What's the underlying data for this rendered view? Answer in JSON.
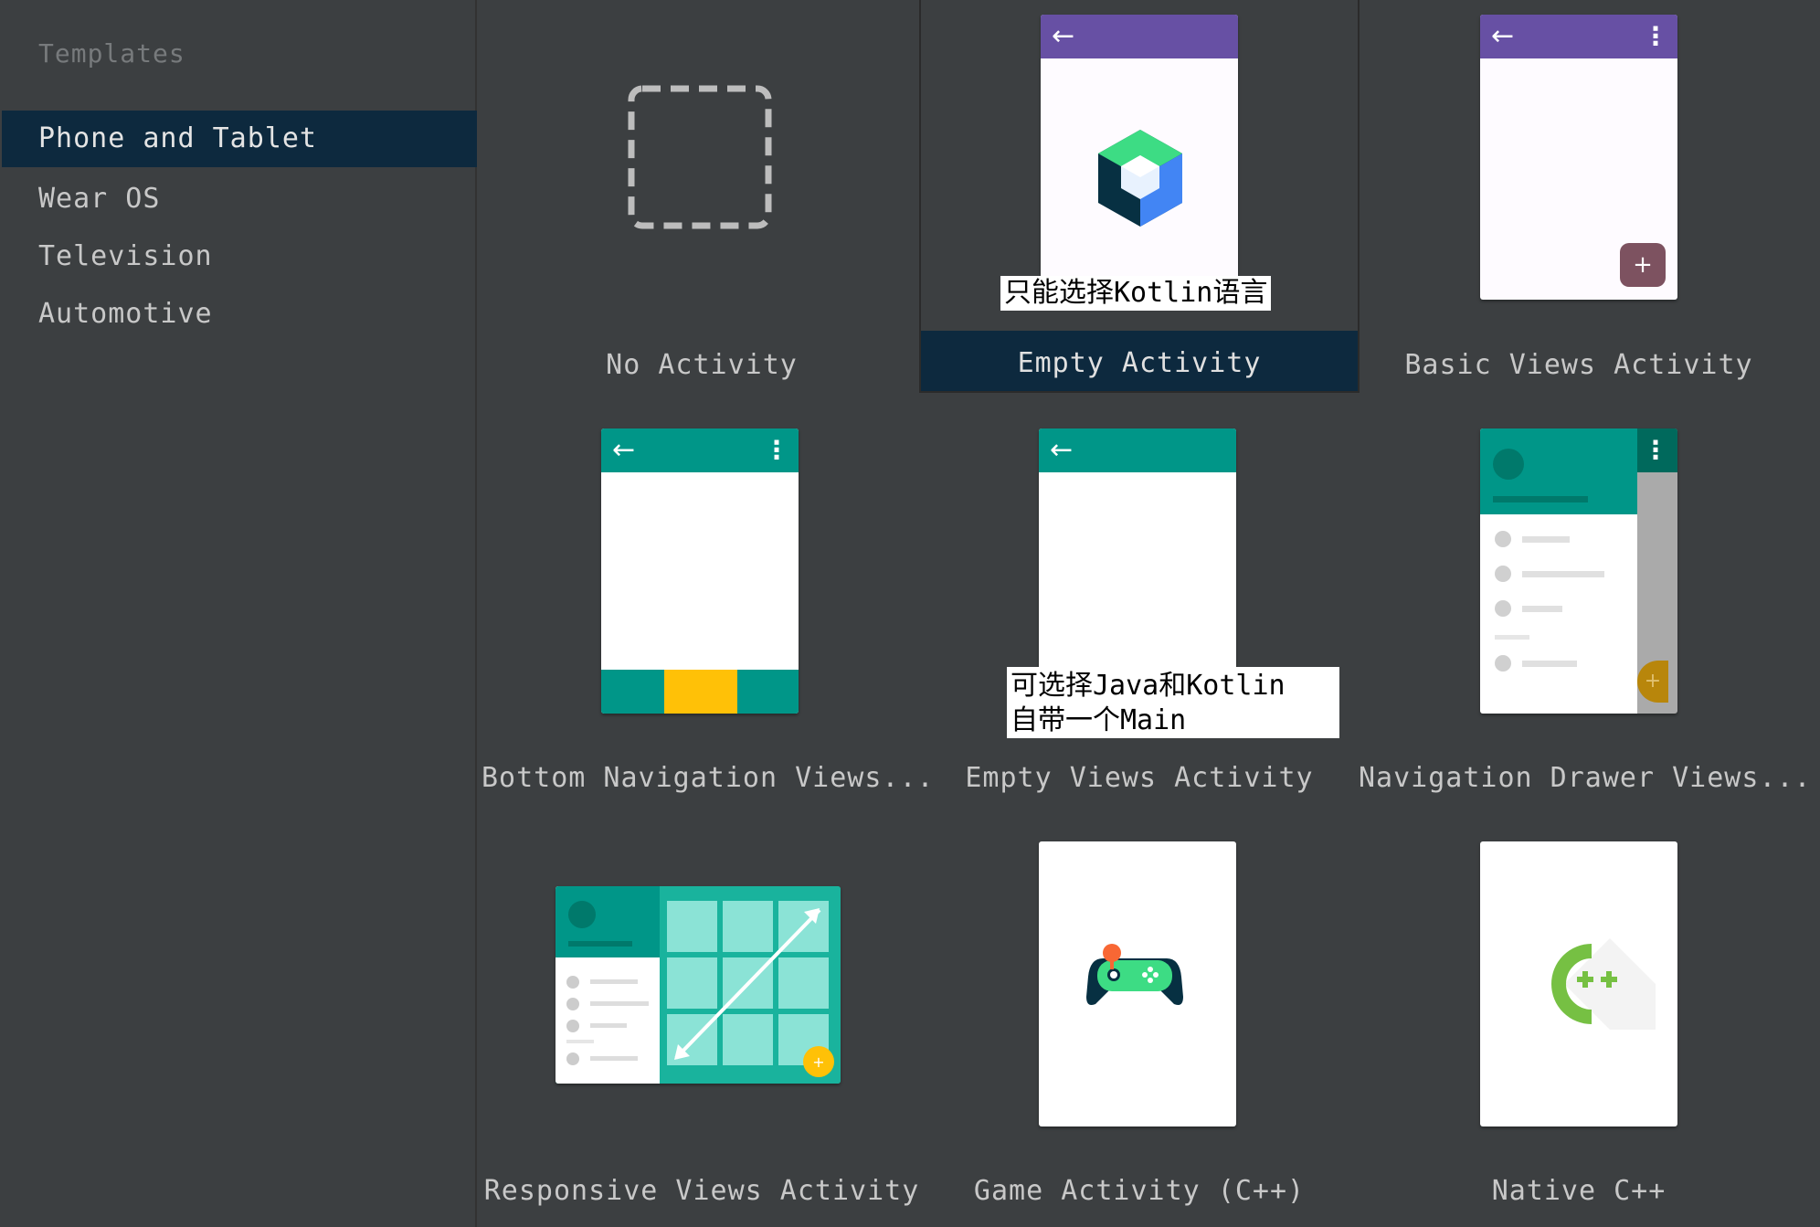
{
  "sidebar": {
    "title": "Templates",
    "items": [
      {
        "label": "Phone and Tablet",
        "active": true
      },
      {
        "label": "Wear OS",
        "active": false
      },
      {
        "label": "Television",
        "active": false
      },
      {
        "label": "Automotive",
        "active": false
      }
    ]
  },
  "templates": [
    {
      "label": "No Activity",
      "icon": "dashed-square-icon"
    },
    {
      "label": "Empty Activity",
      "icon": "compose-logo-icon",
      "selected": true,
      "note": "只能选择Kotlin语言"
    },
    {
      "label": "Basic Views Activity",
      "icon": "phone-fab-icon"
    },
    {
      "label": "Bottom Navigation Views...",
      "icon": "bottom-nav-phone-icon"
    },
    {
      "label": "Empty Views Activity",
      "icon": "empty-phone-icon",
      "note_line1": "可选择Java和Kotlin",
      "note_line2": "自带一个Main"
    },
    {
      "label": "Navigation Drawer Views...",
      "icon": "nav-drawer-phone-icon"
    },
    {
      "label": "Responsive Views Activity",
      "icon": "responsive-tablet-icon"
    },
    {
      "label": "Game Activity (C++)",
      "icon": "gamepad-icon"
    },
    {
      "label": "Native C++",
      "icon": "cpp-logo-icon"
    }
  ],
  "colors": {
    "background": "#3c3f41",
    "selection": "#0d293e",
    "purple_appbar": "#6750a4",
    "teal": "#009688",
    "amber": "#ffc107",
    "fab": "#7d5260"
  },
  "glyphs": {
    "fab_plus": "+",
    "back_arrow": "←",
    "overflow_dots": "⋮"
  }
}
